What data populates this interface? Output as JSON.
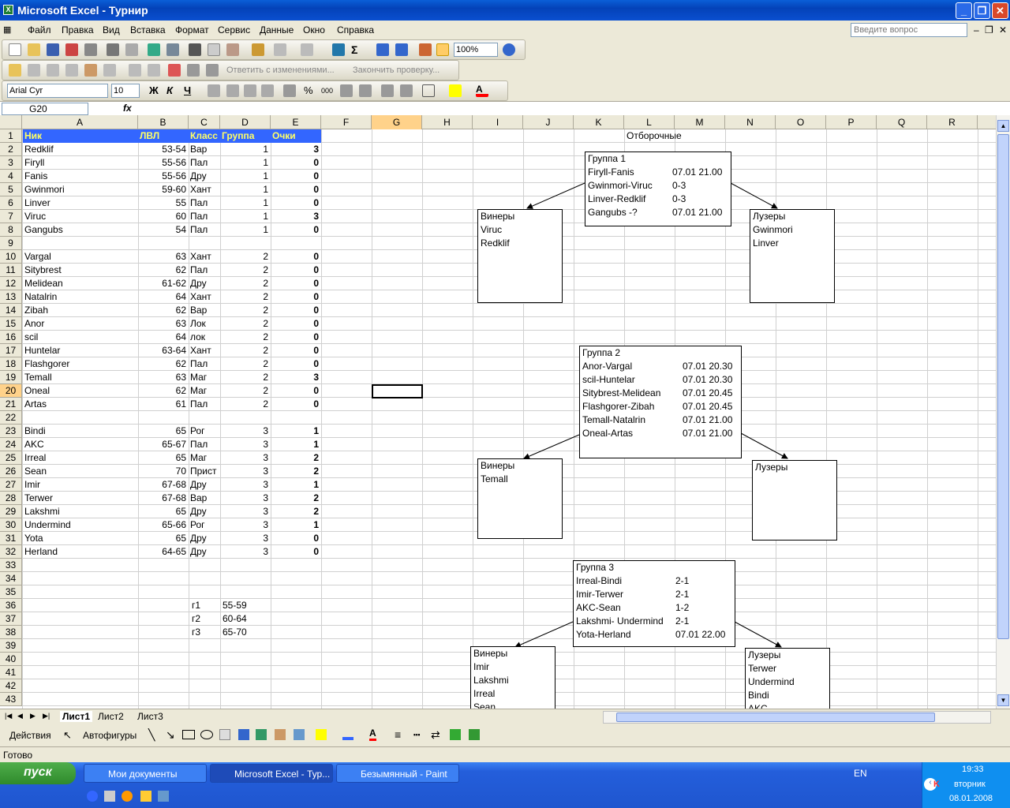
{
  "window": {
    "title": "Microsoft Excel - Турнир"
  },
  "menu": [
    "Файл",
    "Правка",
    "Вид",
    "Вставка",
    "Формат",
    "Сервис",
    "Данные",
    "Окно",
    "Справка"
  ],
  "ask_placeholder": "Введите вопрос",
  "toolbar": {
    "zoom": "100%",
    "review_text": "Ответить с изменениями...",
    "end_review": "Закончить проверку...",
    "font": "Arial Cyr",
    "size": "10"
  },
  "formula": {
    "namebox": "G20",
    "fx": "fx"
  },
  "columns": [
    "A",
    "B",
    "C",
    "D",
    "E",
    "F",
    "G",
    "H",
    "I",
    "J",
    "K",
    "L",
    "M",
    "N",
    "O",
    "P",
    "Q",
    "R"
  ],
  "rows": [
    "1",
    "2",
    "3",
    "4",
    "5",
    "6",
    "7",
    "8",
    "9",
    "10",
    "11",
    "12",
    "13",
    "14",
    "15",
    "16",
    "17",
    "18",
    "19",
    "20",
    "21",
    "22",
    "23",
    "24",
    "25",
    "26",
    "27",
    "28",
    "29",
    "30",
    "31",
    "32",
    "33",
    "34",
    "35",
    "36",
    "37",
    "38",
    "39",
    "40",
    "41",
    "42",
    "43"
  ],
  "headers": [
    "Ник",
    "ЛВЛ",
    "Класс",
    "Группа",
    "Очки"
  ],
  "table": [
    {
      "r": 2,
      "nick": "Redklif",
      "lvl": "53-54",
      "cls": "Вар",
      "grp": "1",
      "pts": "3"
    },
    {
      "r": 3,
      "nick": "Firyll",
      "lvl": "55-56",
      "cls": "Пал",
      "grp": "1",
      "pts": "0"
    },
    {
      "r": 4,
      "nick": "Fanis",
      "lvl": "55-56",
      "cls": "Дру",
      "grp": "1",
      "pts": "0"
    },
    {
      "r": 5,
      "nick": "Gwinmori",
      "lvl": "59-60",
      "cls": "Хант",
      "grp": "1",
      "pts": "0"
    },
    {
      "r": 6,
      "nick": "Linver",
      "lvl": "55",
      "cls": "Пал",
      "grp": "1",
      "pts": "0"
    },
    {
      "r": 7,
      "nick": "Viruc",
      "lvl": "60",
      "cls": "Пал",
      "grp": "1",
      "pts": "3"
    },
    {
      "r": 8,
      "nick": "Gangubs",
      "lvl": "54",
      "cls": "Пал",
      "grp": "1",
      "pts": "0"
    },
    {
      "r": 10,
      "nick": "Vargal",
      "lvl": "63",
      "cls": "Хант",
      "grp": "2",
      "pts": "0"
    },
    {
      "r": 11,
      "nick": "Sitybrest",
      "lvl": "62",
      "cls": "Пал",
      "grp": "2",
      "pts": "0"
    },
    {
      "r": 12,
      "nick": "Melidean",
      "lvl": "61-62",
      "cls": "Дру",
      "grp": "2",
      "pts": "0"
    },
    {
      "r": 13,
      "nick": "Natalrin",
      "lvl": "64",
      "cls": "Хант",
      "grp": "2",
      "pts": "0"
    },
    {
      "r": 14,
      "nick": "Zibah",
      "lvl": "62",
      "cls": "Вар",
      "grp": "2",
      "pts": "0"
    },
    {
      "r": 15,
      "nick": "Anor",
      "lvl": "63",
      "cls": "Лок",
      "grp": "2",
      "pts": "0"
    },
    {
      "r": 16,
      "nick": "scil",
      "lvl": "64",
      "cls": "лок",
      "grp": "2",
      "pts": "0"
    },
    {
      "r": 17,
      "nick": "Huntelar",
      "lvl": "63-64",
      "cls": "Хант",
      "grp": "2",
      "pts": "0"
    },
    {
      "r": 18,
      "nick": "Flashgorer",
      "lvl": "62",
      "cls": "Пал",
      "grp": "2",
      "pts": "0"
    },
    {
      "r": 19,
      "nick": "Temall",
      "lvl": "63",
      "cls": "Маг",
      "grp": "2",
      "pts": "3"
    },
    {
      "r": 20,
      "nick": "Oneal",
      "lvl": "62",
      "cls": "Маг",
      "grp": "2",
      "pts": "0"
    },
    {
      "r": 21,
      "nick": "Artas",
      "lvl": "61",
      "cls": "Пал",
      "grp": "2",
      "pts": "0"
    },
    {
      "r": 23,
      "nick": "Bindi",
      "lvl": "65",
      "cls": "Рог",
      "grp": "3",
      "pts": "1"
    },
    {
      "r": 24,
      "nick": "AKC",
      "lvl": "65-67",
      "cls": "Пал",
      "grp": "3",
      "pts": "1"
    },
    {
      "r": 25,
      "nick": "Irreal",
      "lvl": "65",
      "cls": "Маг",
      "grp": "3",
      "pts": "2"
    },
    {
      "r": 26,
      "nick": "Sean",
      "lvl": "70",
      "cls": "Прист",
      "grp": "3",
      "pts": "2"
    },
    {
      "r": 27,
      "nick": "Imir",
      "lvl": "67-68",
      "cls": "Дру",
      "grp": "3",
      "pts": "1"
    },
    {
      "r": 28,
      "nick": "Terwer",
      "lvl": "67-68",
      "cls": "Вар",
      "grp": "3",
      "pts": "2"
    },
    {
      "r": 29,
      "nick": "Lakshmi",
      "lvl": "65",
      "cls": "Дру",
      "grp": "3",
      "pts": "2"
    },
    {
      "r": 30,
      "nick": "Undermind",
      "lvl": "65-66",
      "cls": "Рог",
      "grp": "3",
      "pts": "1"
    },
    {
      "r": 31,
      "nick": "Yota",
      "lvl": "65",
      "cls": "Дру",
      "grp": "3",
      "pts": "0"
    },
    {
      "r": 32,
      "nick": "Herland",
      "lvl": "64-65",
      "cls": "Дру",
      "grp": "3",
      "pts": "0"
    }
  ],
  "ranges": [
    {
      "r": 36,
      "k": "г1",
      "v": "55-59"
    },
    {
      "r": 37,
      "k": "г2",
      "v": "60-64"
    },
    {
      "r": 38,
      "k": "г3",
      "v": "65-70"
    }
  ],
  "qualifying": "Отборочные",
  "groups": {
    "g1": {
      "title": "Группа 1",
      "lines": [
        [
          "Firyll-Fanis",
          "07.01 21.00"
        ],
        [
          "Gwinmori-Viruc",
          "0-3"
        ],
        [
          "Linver-Redklif",
          "0-3"
        ],
        [
          "Gangubs -?",
          "07.01 21.00"
        ]
      ]
    },
    "g2": {
      "title": "Группа 2",
      "lines": [
        [
          "Anor-Vargal",
          "07.01 20.30"
        ],
        [
          "scil-Huntelar",
          "07.01 20.30"
        ],
        [
          "Sitybrest-Melidean",
          "07.01 20.45"
        ],
        [
          "Flashgorer-Zibah",
          "07.01 20.45"
        ],
        [
          "Temall-Natalrin",
          "07.01 21.00"
        ],
        [
          "Oneal-Artas",
          "07.01 21.00"
        ]
      ]
    },
    "g3": {
      "title": "Группа 3",
      "lines": [
        [
          "Irreal-Bindi",
          "2-1"
        ],
        [
          "Imir-Terwer",
          "2-1"
        ],
        [
          "AKC-Sean",
          "1-2"
        ],
        [
          "Lakshmi- Undermind",
          "2-1"
        ],
        [
          "Yota-Herland",
          "07.01 22.00"
        ]
      ]
    }
  },
  "results": {
    "w1": [
      "Винеры",
      "Viruc",
      "Redklif"
    ],
    "l1": [
      "Лузеры",
      "Gwinmori",
      "Linver"
    ],
    "w2": [
      "Винеры",
      "Temall"
    ],
    "l2": [
      "Лузеры"
    ],
    "w3": [
      "Винеры",
      "Imir",
      "Lakshmi",
      "Irreal",
      "Sean"
    ],
    "l3": [
      "Лузеры",
      "Terwer",
      "Undermind",
      "Bindi",
      "AKC"
    ]
  },
  "sheets": [
    "Лист1",
    "Лист2",
    "Лист3"
  ],
  "drawbar": {
    "actions": "Действия",
    "autoshapes": "Автофигуры"
  },
  "status": "Готово",
  "taskbar": {
    "start": "пуск",
    "tasks": [
      "Мои документы",
      "Microsoft Excel - Тур...",
      "Безымянный - Paint"
    ],
    "lang": "EN",
    "time": "19:33",
    "day": "вторник",
    "date": "08.01.2008"
  }
}
